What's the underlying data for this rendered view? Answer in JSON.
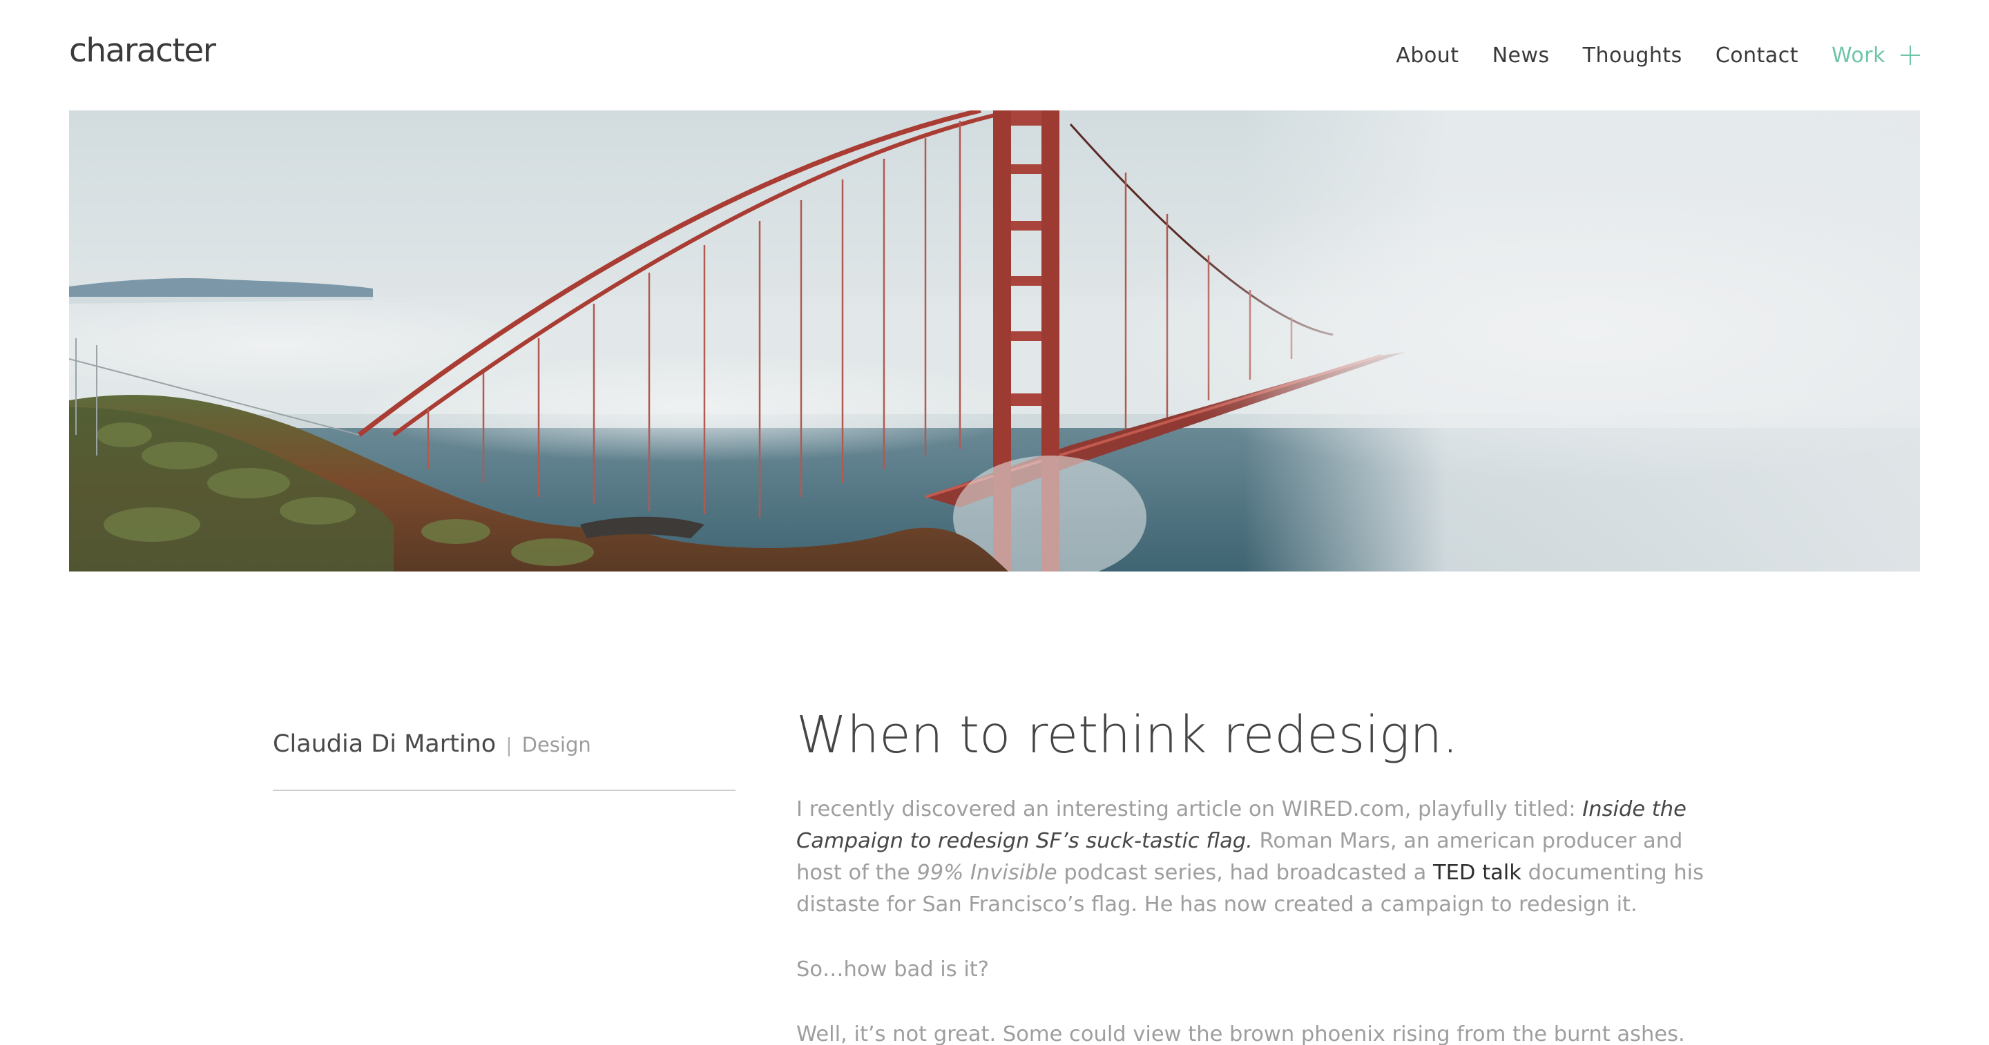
{
  "header": {
    "logo": "character",
    "nav": {
      "about": "About",
      "news": "News",
      "thoughts": "Thoughts",
      "contact": "Contact",
      "work": "Work"
    },
    "accent_color": "#6cc5a8"
  },
  "hero": {
    "icon": "golden-gate-bridge-photo"
  },
  "byline": {
    "author": "Claudia Di Martino",
    "separator": "|",
    "category": "Design"
  },
  "article": {
    "title": "When to rethink redesign.",
    "p1": {
      "intro": "I recently discovered an interesting article on WIRED.com, playfully titled: ",
      "article_title": "Inside the Campaign to redesign SF’s suck-tastic flag.",
      "middle": " Roman Mars, an american producer and host of the ",
      "podcast": "99% Invisible",
      "middle2": " podcast series, had broadcasted a ",
      "link": "TED talk",
      "end": " documenting his distaste for San Francisco’s flag. He has now created a campaign to redesign it."
    },
    "p2": "So…how bad is it?",
    "p3": "Well, it’s not great. Some could view the brown phoenix rising from the burnt ashes."
  }
}
